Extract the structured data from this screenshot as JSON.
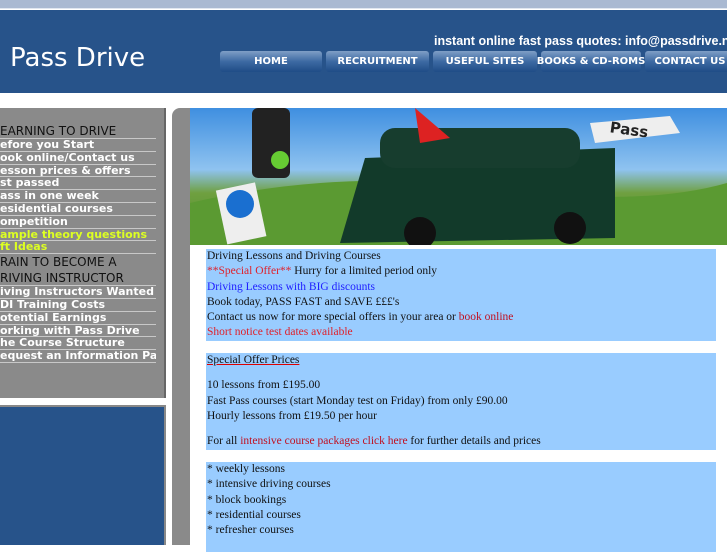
{
  "header": {
    "logo": "Pass Drive",
    "quote": "instant online fast pass quotes: info@passdrive.n",
    "nav": [
      "HOME",
      "RECRUITMENT",
      "USEFUL SITES",
      "BOOKS & CD-ROMS",
      "CONTACT US"
    ]
  },
  "sidebar": {
    "heading1": "EARNING TO DRIVE",
    "items1": [
      "efore you Start",
      "ook online/Contact us",
      "esson prices & offers",
      "st passed",
      "ass in one week",
      "esidential courses",
      "ompetition",
      "ample theory questions",
      "ft Ideas"
    ],
    "heading2a": "RAIN TO BECOME A",
    "heading2b": "RIVING INSTRUCTOR",
    "items2": [
      "iving Instructors Wanted",
      "DI Training Costs",
      "otential Earnings",
      "orking with Pass Drive",
      "he Course Structure",
      "equest an Information Pack"
    ]
  },
  "hero": {
    "sign_text": "Pass"
  },
  "intro": {
    "l1": "Driving Lessons and Driving Courses",
    "offer": "**Special Offer**",
    "l2b": " Hurry for a limited period only",
    "l3": "Driving Lessons with BIG discounts",
    "l4": "Book today, PASS FAST and SAVE £££'s",
    "l5a": "Contact us now for more special offers in your area or ",
    "l5link": "book online",
    "l6": "Short notice test dates available"
  },
  "prices": {
    "title": "Special Offer Prices",
    "p1": "10 lessons from £195.00",
    "p2": "Fast Pass courses (start Monday test on Friday) from only £90.00",
    "p3": "Hourly lessons from £19.50 per hour",
    "fa": "For all ",
    "flink": "intensive course packages click here",
    "fb": " for further details and prices"
  },
  "courses": [
    "* weekly lessons",
    "* intensive driving courses",
    "* block bookings",
    "* residential courses",
    "* refresher courses"
  ]
}
